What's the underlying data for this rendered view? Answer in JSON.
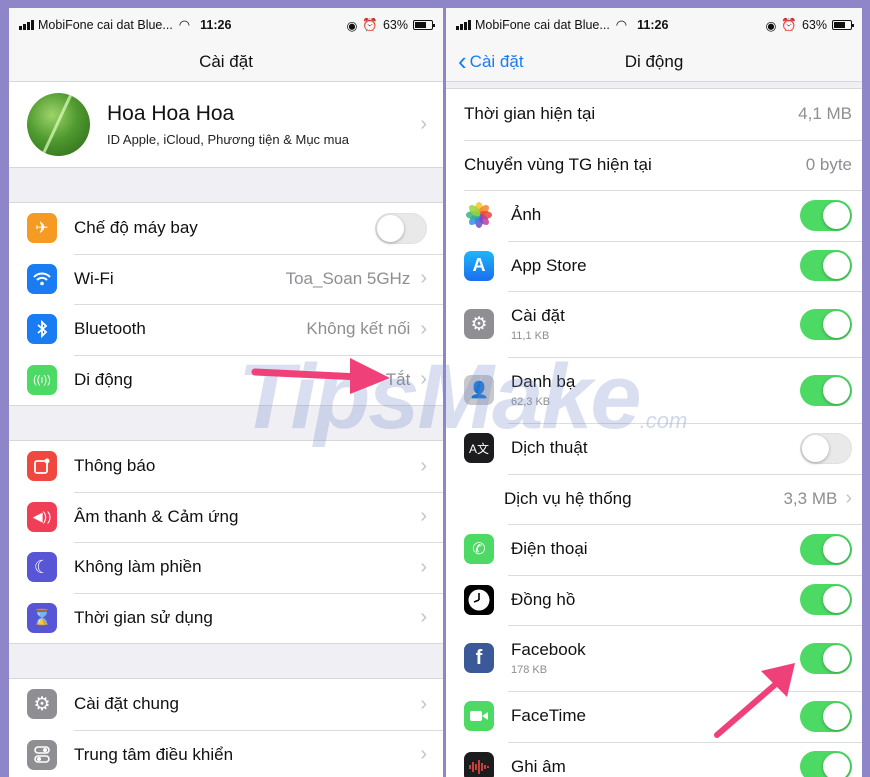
{
  "status_bar": {
    "left": {
      "carrier": "MobiFone cai dat Blue...",
      "time": "11:26",
      "battery": "63%"
    },
    "right": {
      "carrier": "MobiFone cai dat Blue...",
      "time": "11:26",
      "battery": "63%"
    }
  },
  "left_screen": {
    "title": "Cài đặt",
    "profile": {
      "name": "Hoa Hoa Hoa",
      "subtitle": "ID Apple, iCloud, Phương tiện & Mục mua"
    },
    "group1": [
      {
        "label": "Chế độ máy bay",
        "icon": "airplane-icon",
        "color": "#f59a23",
        "toggle": false
      },
      {
        "label": "Wi-Fi",
        "icon": "wifi-icon",
        "color": "#1a7cf2",
        "value": "Toa_Soan 5GHz"
      },
      {
        "label": "Bluetooth",
        "icon": "bluetooth-icon",
        "color": "#1a7cf2",
        "value": "Không kết nối"
      },
      {
        "label": "Di động",
        "icon": "cellular-icon",
        "color": "#4cd964",
        "value": "Tắt"
      }
    ],
    "group2": [
      {
        "label": "Thông báo",
        "icon": "notification-icon",
        "color": "#f0483e"
      },
      {
        "label": "Âm thanh & Cảm ứng",
        "icon": "sound-icon",
        "color": "#f03e56"
      },
      {
        "label": "Không làm phiền",
        "icon": "moon-icon",
        "color": "#5856d6"
      },
      {
        "label": "Thời gian sử dụng",
        "icon": "hourglass-icon",
        "color": "#5856d6"
      }
    ],
    "group3": [
      {
        "label": "Cài đặt chung",
        "icon": "gear-icon",
        "color": "#8e8e93"
      },
      {
        "label": "Trung tâm điều khiển",
        "icon": "control-center-icon",
        "color": "#8e8e93"
      }
    ]
  },
  "right_screen": {
    "back_label": "Cài đặt",
    "title": "Di động",
    "current_period": {
      "label": "Thời gian hiện tại",
      "value": "4,1 MB"
    },
    "roaming": {
      "label": "Chuyển vùng TG hiện tại",
      "value": "0 byte"
    },
    "apps": [
      {
        "label": "Ảnh",
        "icon": "photos-icon",
        "on": true
      },
      {
        "label": "App Store",
        "icon": "app-store-icon",
        "on": true
      },
      {
        "label": "Cài đặt",
        "sub": "11,1 KB",
        "icon": "settings-icon",
        "on": true
      },
      {
        "label": "Danh bạ",
        "sub": "62,3 KB",
        "icon": "contacts-icon",
        "on": true
      },
      {
        "label": "Dịch thuật",
        "icon": "translate-icon",
        "on": false
      }
    ],
    "system_services": {
      "label": "Dịch vụ hệ thống",
      "value": "3,3 MB"
    },
    "apps2": [
      {
        "label": "Điện thoại",
        "icon": "phone-icon",
        "on": true
      },
      {
        "label": "Đồng hồ",
        "icon": "clock-icon",
        "on": true
      },
      {
        "label": "Facebook",
        "sub": "178 KB",
        "icon": "facebook-icon",
        "on": true
      },
      {
        "label": "FaceTime",
        "icon": "facetime-icon",
        "on": true
      },
      {
        "label": "Ghi âm",
        "icon": "voice-memo-icon",
        "on": true
      }
    ]
  },
  "watermark": {
    "text": "TipsMake",
    "suffix": ".com"
  },
  "colors": {
    "accent": "#1a7cf2",
    "toggle_on": "#4cd964",
    "arrow": "#f0407a"
  }
}
